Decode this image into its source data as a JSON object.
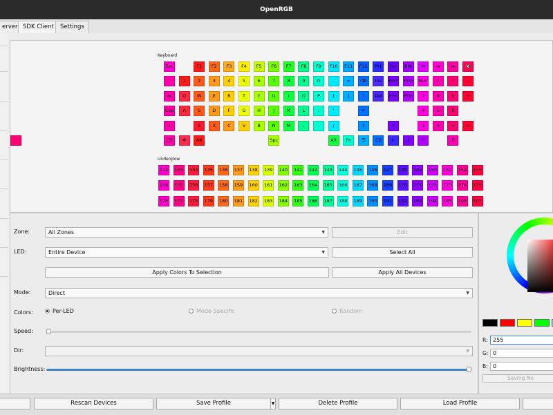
{
  "window": {
    "title": "OpenRGB"
  },
  "tabs": [
    {
      "label": "erver"
    },
    {
      "label": "SDK Client"
    },
    {
      "label": "Settings"
    }
  ],
  "keyboard_zone": {
    "label": "Keyboard",
    "rows": [
      [
        {
          "label": "Esc",
          "color": "#ff00cc"
        },
        {
          "label": "F1",
          "color": "#ff1a1a"
        },
        {
          "label": "F2",
          "color": "#ff6a1a"
        },
        {
          "label": "F3",
          "color": "#ffaa1a"
        },
        {
          "label": "F4",
          "color": "#ffee00"
        },
        {
          "label": "F5",
          "color": "#c8ff00"
        },
        {
          "label": "F6",
          "color": "#7aff00"
        },
        {
          "label": "F7",
          "color": "#22ff22"
        },
        {
          "label": "F8",
          "color": "#00ff88"
        },
        {
          "label": "F9",
          "color": "#00ffcc"
        },
        {
          "label": "F10",
          "color": "#00e5ff"
        },
        {
          "label": "F11",
          "color": "#00a8ff"
        },
        {
          "label": "F12",
          "color": "#0060ff"
        },
        {
          "label": "Prt",
          "color": "#2a2aff"
        },
        {
          "label": "Scr",
          "color": "#6a00ff"
        },
        {
          "label": "Brk",
          "color": "#a000ff"
        },
        {
          "label": "⏮",
          "color": "#e000ff"
        },
        {
          "label": "⏯",
          "color": "#ff00d0"
        },
        {
          "label": "⏭",
          "color": "#ff00a0"
        },
        {
          "label": "🔇",
          "color": "#ff0055"
        }
      ],
      [
        {
          "label": "`",
          "color": "#ff00aa"
        },
        {
          "label": "1",
          "color": "#ff1a1a"
        },
        {
          "label": "2",
          "color": "#ff5a1a"
        },
        {
          "label": "3",
          "color": "#ff9a1a"
        },
        {
          "label": "4",
          "color": "#ffd000"
        },
        {
          "label": "5",
          "color": "#eaff00"
        },
        {
          "label": "6",
          "color": "#a8ff00"
        },
        {
          "label": "7",
          "color": "#5aff00"
        },
        {
          "label": "8",
          "color": "#10ff40"
        },
        {
          "label": "9",
          "color": "#00ff90"
        },
        {
          "label": "0",
          "color": "#00ffd0"
        },
        {
          "label": "-",
          "color": "#00eaff"
        },
        {
          "label": "=",
          "color": "#00b0ff"
        },
        {
          "label": "⌫",
          "color": "#0070ff"
        },
        {
          "label": "Ins",
          "color": "#4a2aff"
        },
        {
          "label": "Hom",
          "color": "#7a00ff"
        },
        {
          "label": "PUp",
          "color": "#b000ff"
        },
        {
          "label": "Num",
          "color": "#ff00e0"
        },
        {
          "label": "/",
          "color": "#ff00b0"
        },
        {
          "label": "*",
          "color": "#ff0070"
        },
        {
          "label": "-",
          "color": "#ff0030"
        }
      ],
      [
        {
          "label": "⇆",
          "color": "#ff00aa"
        },
        {
          "label": "Q",
          "color": "#ff2a40"
        },
        {
          "label": "W",
          "color": "#ff5a1a"
        },
        {
          "label": "E",
          "color": "#ff9a1a"
        },
        {
          "label": "R",
          "color": "#ffd000"
        },
        {
          "label": "T",
          "color": "#eaff00"
        },
        {
          "label": "Y",
          "color": "#a8ff00"
        },
        {
          "label": "U",
          "color": "#5aff00"
        },
        {
          "label": "I",
          "color": "#10ff40"
        },
        {
          "label": "O",
          "color": "#00ff90"
        },
        {
          "label": "P",
          "color": "#00ffd0"
        },
        {
          "label": "[",
          "color": "#00eaff"
        },
        {
          "label": "]",
          "color": "#00b0ff"
        },
        {
          "label": "\\",
          "color": "#0070ff"
        },
        {
          "label": "Del",
          "color": "#4a2aff"
        },
        {
          "label": "End",
          "color": "#7a00ff"
        },
        {
          "label": "PDn",
          "color": "#b000ff"
        },
        {
          "label": "7",
          "color": "#ff00e0"
        },
        {
          "label": "8",
          "color": "#ff00b0"
        },
        {
          "label": "9",
          "color": "#ff0070"
        },
        {
          "label": "+",
          "color": "#ff0030"
        }
      ],
      [
        {
          "label": "Cap",
          "color": "#ff00aa"
        },
        {
          "label": "A",
          "color": "#ff2a40"
        },
        {
          "label": "S",
          "color": "#ff5a1a"
        },
        {
          "label": "D",
          "color": "#ff9a1a"
        },
        {
          "label": "F",
          "color": "#ffd000"
        },
        {
          "label": "G",
          "color": "#eaff00"
        },
        {
          "label": "H",
          "color": "#a8ff00"
        },
        {
          "label": "J",
          "color": "#5aff00"
        },
        {
          "label": "K",
          "color": "#10ff40"
        },
        {
          "label": "L",
          "color": "#00ff90"
        },
        {
          "label": ";",
          "color": "#00ffd0"
        },
        {
          "label": "'",
          "color": "#00eaff"
        },
        {
          "label": "↵",
          "color": "#0070ff"
        },
        {
          "label": "4",
          "color": "#ff00e0"
        },
        {
          "label": "5",
          "color": "#ff00b0"
        },
        {
          "label": "6",
          "color": "#ff0070"
        }
      ],
      [
        {
          "label": "⇧",
          "color": "#ff00aa"
        },
        {
          "label": "Z",
          "color": "#ff1a30"
        },
        {
          "label": "X",
          "color": "#ff5a1a"
        },
        {
          "label": "C",
          "color": "#ff9a1a"
        },
        {
          "label": "V",
          "color": "#ffd000"
        },
        {
          "label": "B",
          "color": "#a8ff00"
        },
        {
          "label": "N",
          "color": "#5aff00"
        },
        {
          "label": "M",
          "color": "#10ff40"
        },
        {
          "label": ",",
          "color": "#00ff90"
        },
        {
          "label": ".",
          "color": "#00ffd0"
        },
        {
          "label": "/",
          "color": "#00eaff"
        },
        {
          "label": "⇧",
          "color": "#0090ff"
        },
        {
          "label": "↑",
          "color": "#7a00ff"
        },
        {
          "label": "1",
          "color": "#ff00e0"
        },
        {
          "label": "2",
          "color": "#ff00b0"
        },
        {
          "label": "3",
          "color": "#ff0070"
        },
        {
          "label": "↵",
          "color": "#ff0030"
        }
      ],
      [
        {
          "label": "Ctl",
          "color": "#ff00aa"
        },
        {
          "label": "❖",
          "color": "#ff2a50"
        },
        {
          "label": "Alt",
          "color": "#ff1a1a"
        },
        {
          "label": "Spc",
          "color": "#a8ff00"
        },
        {
          "label": "Alt",
          "color": "#10ff40"
        },
        {
          "label": "Fn",
          "color": "#00ffd0"
        },
        {
          "label": "☰",
          "color": "#00b0ff"
        },
        {
          "label": "Ctl",
          "color": "#0070ff"
        },
        {
          "label": "←",
          "color": "#3a2aff"
        },
        {
          "label": "↓",
          "color": "#7a00ff"
        },
        {
          "label": "→",
          "color": "#b000ff"
        },
        {
          "label": "0",
          "color": "#ff00b0"
        },
        {
          "label": ".",
          "color": "#ff0070"
        }
      ]
    ]
  },
  "underglow_zone": {
    "label": "Underglow",
    "rows": [
      [
        {
          "label": "132",
          "color": "#ff00cc"
        },
        {
          "label": "133",
          "color": "#ff0088"
        },
        {
          "label": "134",
          "color": "#ff1a40"
        },
        {
          "label": "135",
          "color": "#ff3a1a"
        },
        {
          "label": "136",
          "color": "#ff6a1a"
        },
        {
          "label": "137",
          "color": "#ff9a1a"
        },
        {
          "label": "138",
          "color": "#ffd000"
        },
        {
          "label": "139",
          "color": "#d8ff00"
        },
        {
          "label": "140",
          "color": "#88ff00"
        },
        {
          "label": "141",
          "color": "#33ff10"
        },
        {
          "label": "142",
          "color": "#00ff55"
        },
        {
          "label": "143",
          "color": "#00ff99"
        },
        {
          "label": "144",
          "color": "#00ffdd"
        },
        {
          "label": "145",
          "color": "#00d8ff"
        },
        {
          "label": "146",
          "color": "#0090ff"
        },
        {
          "label": "147",
          "color": "#1a40ff"
        },
        {
          "label": "148",
          "color": "#5a10ff"
        },
        {
          "label": "149",
          "color": "#9000ff"
        },
        {
          "label": "150",
          "color": "#d000ff"
        },
        {
          "label": "151",
          "color": "#ff00dd"
        },
        {
          "label": "152",
          "color": "#ff0099"
        },
        {
          "label": "153",
          "color": "#ff0040"
        }
      ],
      [
        {
          "label": "154",
          "color": "#ff00cc"
        },
        {
          "label": "155",
          "color": "#ff0088"
        },
        {
          "label": "156",
          "color": "#ff1a40"
        },
        {
          "label": "157",
          "color": "#ff3a1a"
        },
        {
          "label": "158",
          "color": "#ff6a1a"
        },
        {
          "label": "159",
          "color": "#ff9a1a"
        },
        {
          "label": "160",
          "color": "#ffd000"
        },
        {
          "label": "161",
          "color": "#d8ff00"
        },
        {
          "label": "162",
          "color": "#88ff00"
        },
        {
          "label": "163",
          "color": "#33ff10"
        },
        {
          "label": "164",
          "color": "#00ff55"
        },
        {
          "label": "165",
          "color": "#00ff99"
        },
        {
          "label": "166",
          "color": "#00ffdd"
        },
        {
          "label": "167",
          "color": "#00d8ff"
        },
        {
          "label": "168",
          "color": "#0090ff"
        },
        {
          "label": "169",
          "color": "#1a40ff"
        },
        {
          "label": "170",
          "color": "#5a10ff"
        },
        {
          "label": "171",
          "color": "#9000ff"
        },
        {
          "label": "172",
          "color": "#d000ff"
        },
        {
          "label": "173",
          "color": "#ff00dd"
        },
        {
          "label": "174",
          "color": "#ff0099"
        },
        {
          "label": "175",
          "color": "#ff0040"
        }
      ],
      [
        {
          "label": "176",
          "color": "#ff00cc"
        },
        {
          "label": "177",
          "color": "#ff0088"
        },
        {
          "label": "178",
          "color": "#ff1a40"
        },
        {
          "label": "179",
          "color": "#ff3a1a"
        },
        {
          "label": "180",
          "color": "#ff6a1a"
        },
        {
          "label": "181",
          "color": "#ff9a1a"
        },
        {
          "label": "182",
          "color": "#ffd000"
        },
        {
          "label": "183",
          "color": "#d8ff00"
        },
        {
          "label": "184",
          "color": "#88ff00"
        },
        {
          "label": "185",
          "color": "#33ff10"
        },
        {
          "label": "186",
          "color": "#00ff55"
        },
        {
          "label": "187",
          "color": "#00ff99"
        },
        {
          "label": "188",
          "color": "#00ffdd"
        },
        {
          "label": "189",
          "color": "#00d8ff"
        },
        {
          "label": "190",
          "color": "#0090ff"
        },
        {
          "label": "191",
          "color": "#1a40ff"
        },
        {
          "label": "192",
          "color": "#5a10ff"
        },
        {
          "label": "193",
          "color": "#9000ff"
        },
        {
          "label": "194",
          "color": "#d000ff"
        },
        {
          "label": "195",
          "color": "#ff00dd"
        },
        {
          "label": "196",
          "color": "#ff0099"
        },
        {
          "label": "197",
          "color": "#ff0040"
        }
      ]
    ]
  },
  "controls": {
    "zone_label": "Zone:",
    "zone_value": "All Zones",
    "edit_button": "Edit",
    "led_label": "LED:",
    "led_value": "Entire Device",
    "select_all_button": "Select All",
    "apply_selection_button": "Apply Colors To Selection",
    "apply_all_button": "Apply All Devices",
    "mode_label": "Mode:",
    "mode_value": "Direct",
    "colors_label": "Colors:",
    "color_option_perled": "Per-LED",
    "color_option_mode_specific": "Mode-Specific",
    "color_option_random": "Random",
    "speed_label": "Speed:",
    "dir_label": "Dir:",
    "brightness_label": "Brightness:",
    "brightness_level": 1.0
  },
  "color_picker": {
    "swatches": [
      "#000000",
      "#ff0000",
      "#ffff00",
      "#00ff00",
      "#00ffff"
    ],
    "r_label": "R:",
    "r_value": "255",
    "g_label": "G:",
    "g_value": "0",
    "b_label": "B:",
    "b_value": "0",
    "save_button": "Saving No"
  },
  "bottom_bar": {
    "rescan_button": "Rescan Devices",
    "save_profile_button": "Save Profile",
    "delete_profile_button": "Delete Profile",
    "load_profile_button": "Load Profile"
  }
}
